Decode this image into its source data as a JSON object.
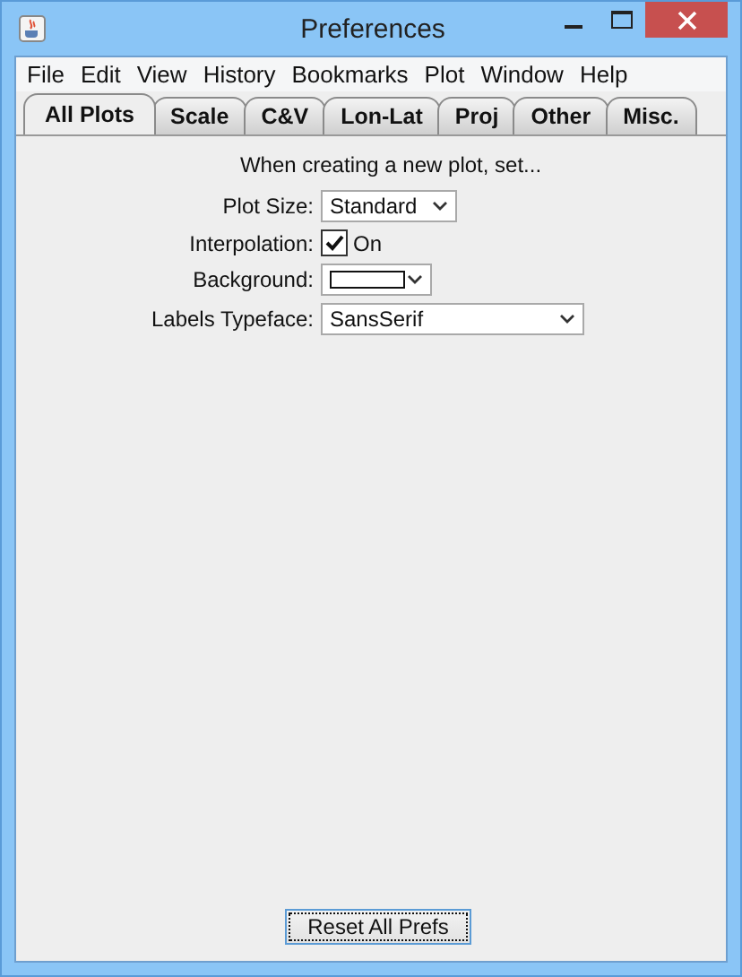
{
  "window": {
    "title": "Preferences"
  },
  "menu": [
    "File",
    "Edit",
    "View",
    "History",
    "Bookmarks",
    "Plot",
    "Window",
    "Help"
  ],
  "tabs": [
    {
      "label": "All Plots",
      "selected": true
    },
    {
      "label": "Scale",
      "selected": false
    },
    {
      "label": "C&V",
      "selected": false
    },
    {
      "label": "Lon-Lat",
      "selected": false
    },
    {
      "label": "Proj",
      "selected": false
    },
    {
      "label": "Other",
      "selected": false
    },
    {
      "label": "Misc.",
      "selected": false
    }
  ],
  "heading": "When creating a new plot, set...",
  "settings": [
    {
      "kind": "dropdown",
      "label": "Plot Size:",
      "value": "Standard",
      "wide": false
    },
    {
      "kind": "checkbox",
      "label": "Interpolation:",
      "value": "On",
      "checked": true
    },
    {
      "kind": "color",
      "label": "Background:",
      "color": "#ffffff"
    },
    {
      "kind": "dropdown",
      "label": "Labels Typeface:",
      "value": "SansSerif",
      "wide": true
    }
  ],
  "reset_button": "Reset All Prefs"
}
